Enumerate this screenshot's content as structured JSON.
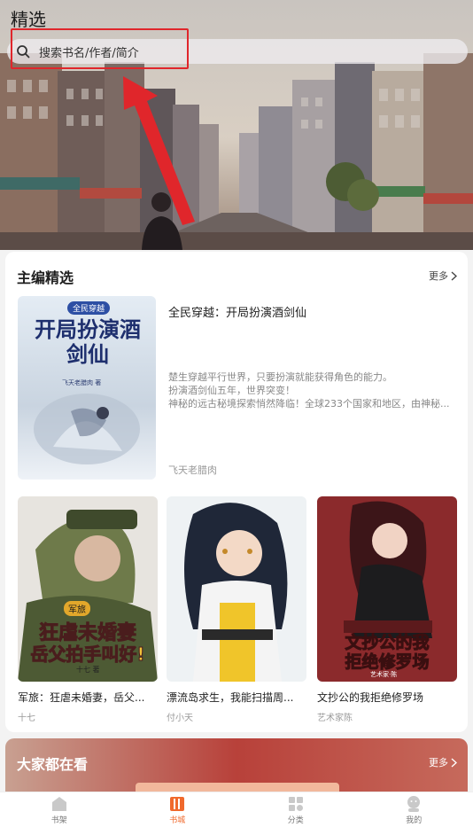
{
  "header": {
    "title": "精选",
    "search_placeholder": "搜索书名/作者/简介"
  },
  "editor_picks": {
    "title": "主编精选",
    "more_label": "更多",
    "featured": {
      "title": "全民穿越：开局扮演酒剑仙",
      "cover_title": "开局扮演酒剑仙",
      "cover_tag": "全民穿越",
      "cover_author": "飞天老腊肉 著",
      "description": [
        "楚生穿越平行世界，只要扮演就能获得角色的能力。",
        "扮演酒剑仙五年，世界突变！",
        "神秘的远古秘境探索悄然降临！全球233个国家和地区，由神秘..."
      ],
      "author": "飞天老腊肉"
    },
    "books": [
      {
        "title": "军旅：狂虐未婚妻，岳父...",
        "author": "十七",
        "cover_text_1": "狂虐未婚妻",
        "cover_text_2": "岳父拍手叫好!",
        "cover_tag": "军旅",
        "cover_author": "十七 著"
      },
      {
        "title": "漂流岛求生，我能扫描周...",
        "author": "付小天"
      },
      {
        "title": "文抄公的我拒绝修罗场",
        "author": "艺术家陈",
        "cover_text_1": "文抄公的我",
        "cover_text_2": "拒绝修罗场",
        "cover_author": "艺术家·陈"
      }
    ]
  },
  "popular": {
    "title": "大家都在看",
    "more_label": "更多"
  },
  "bottom_nav": {
    "items": [
      {
        "label": "书架",
        "icon": "bookshelf-icon",
        "active": false
      },
      {
        "label": "书城",
        "icon": "bookstore-icon",
        "active": true
      },
      {
        "label": "分类",
        "icon": "category-icon",
        "active": false
      },
      {
        "label": "我的",
        "icon": "profile-icon",
        "active": false
      }
    ]
  },
  "colors": {
    "accent": "#f0692c",
    "annotation": "#e0262b"
  }
}
